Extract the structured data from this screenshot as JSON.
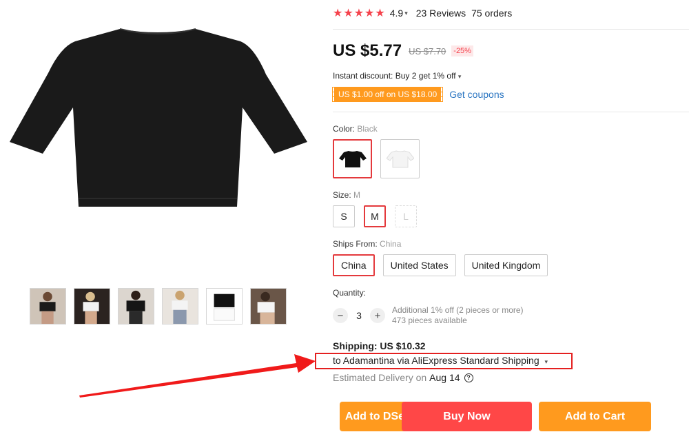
{
  "rating": {
    "stars": "★★★★★",
    "value": "4.9",
    "reviews": "23 Reviews",
    "orders": "75 orders"
  },
  "price": {
    "current": "US $5.77",
    "original": "US $7.70",
    "discount": "-25%"
  },
  "instant_discount": "Instant discount: Buy 2 get 1% off",
  "coupon": {
    "label": "US $1.00 off on US $18.00",
    "link": "Get coupons"
  },
  "color": {
    "label": "Color:",
    "selected": "Black",
    "options": [
      "Black",
      "White"
    ]
  },
  "size": {
    "label": "Size:",
    "selected": "M",
    "options": [
      "S",
      "M",
      "L"
    ]
  },
  "ships_from": {
    "label": "Ships From:",
    "selected": "China",
    "options": [
      "China",
      "United States",
      "United Kingdom"
    ]
  },
  "quantity": {
    "label": "Quantity:",
    "value": "3",
    "minus": "−",
    "plus": "+",
    "note1": "Additional 1% off (2 pieces or more)",
    "note2": "473 pieces available"
  },
  "shipping": {
    "title": "Shipping: US $10.32",
    "method": "to Adamantina via AliExpress Standard Shipping",
    "delivery_label": "Estimated Delivery on",
    "delivery_date": "Aug 14",
    "help": "?"
  },
  "buttons": {
    "dsers": "Add to DSers",
    "buy": "Buy Now",
    "cart": "Add to Cart"
  },
  "colors": {
    "accent_red": "#e4393c",
    "orange": "#ff9a1e",
    "buy_red": "#ff4747",
    "link_blue": "#2b76c2"
  },
  "icons": {
    "chevron": "chevron-down-icon",
    "help": "question-circle-icon",
    "star": "star-icon"
  }
}
